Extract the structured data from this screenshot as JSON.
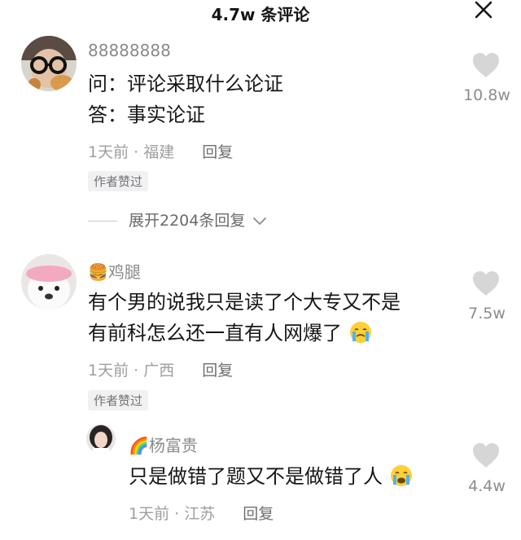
{
  "header": {
    "title": "4.7w 条评论"
  },
  "comments": [
    {
      "user": "88888888",
      "lines": [
        "问：评论采取什么论证",
        "答：事实论证"
      ],
      "time": "1天前",
      "location": "福建",
      "reply": "回复",
      "badge": "作者赞过",
      "likes": "10.8w",
      "expand": "展开2204条回复"
    },
    {
      "user": "鸡腿",
      "user_emoji": "🍔",
      "lines": [
        "有个男的说我只是读了个大专又不是",
        "有前科怎么还一直有人网爆了"
      ],
      "time": "1天前",
      "location": "广西",
      "reply": "回复",
      "badge": "作者赞过",
      "likes": "7.5w"
    }
  ],
  "reply": {
    "user": "杨富贵",
    "user_emoji": "🌈",
    "text": "只是做错了题又不是做错了人",
    "time": "1天前",
    "location": "江苏",
    "reply": "回复",
    "likes": "4.4w"
  },
  "icons": {
    "like": "heart-icon",
    "close": "close-icon",
    "expand": "chevron-down-icon",
    "crying": "crying-face-icon"
  },
  "colors": {
    "like_icon": "#d6d6d6",
    "meta": "#9e9e9e",
    "badge_bg": "#f1f1f3"
  }
}
